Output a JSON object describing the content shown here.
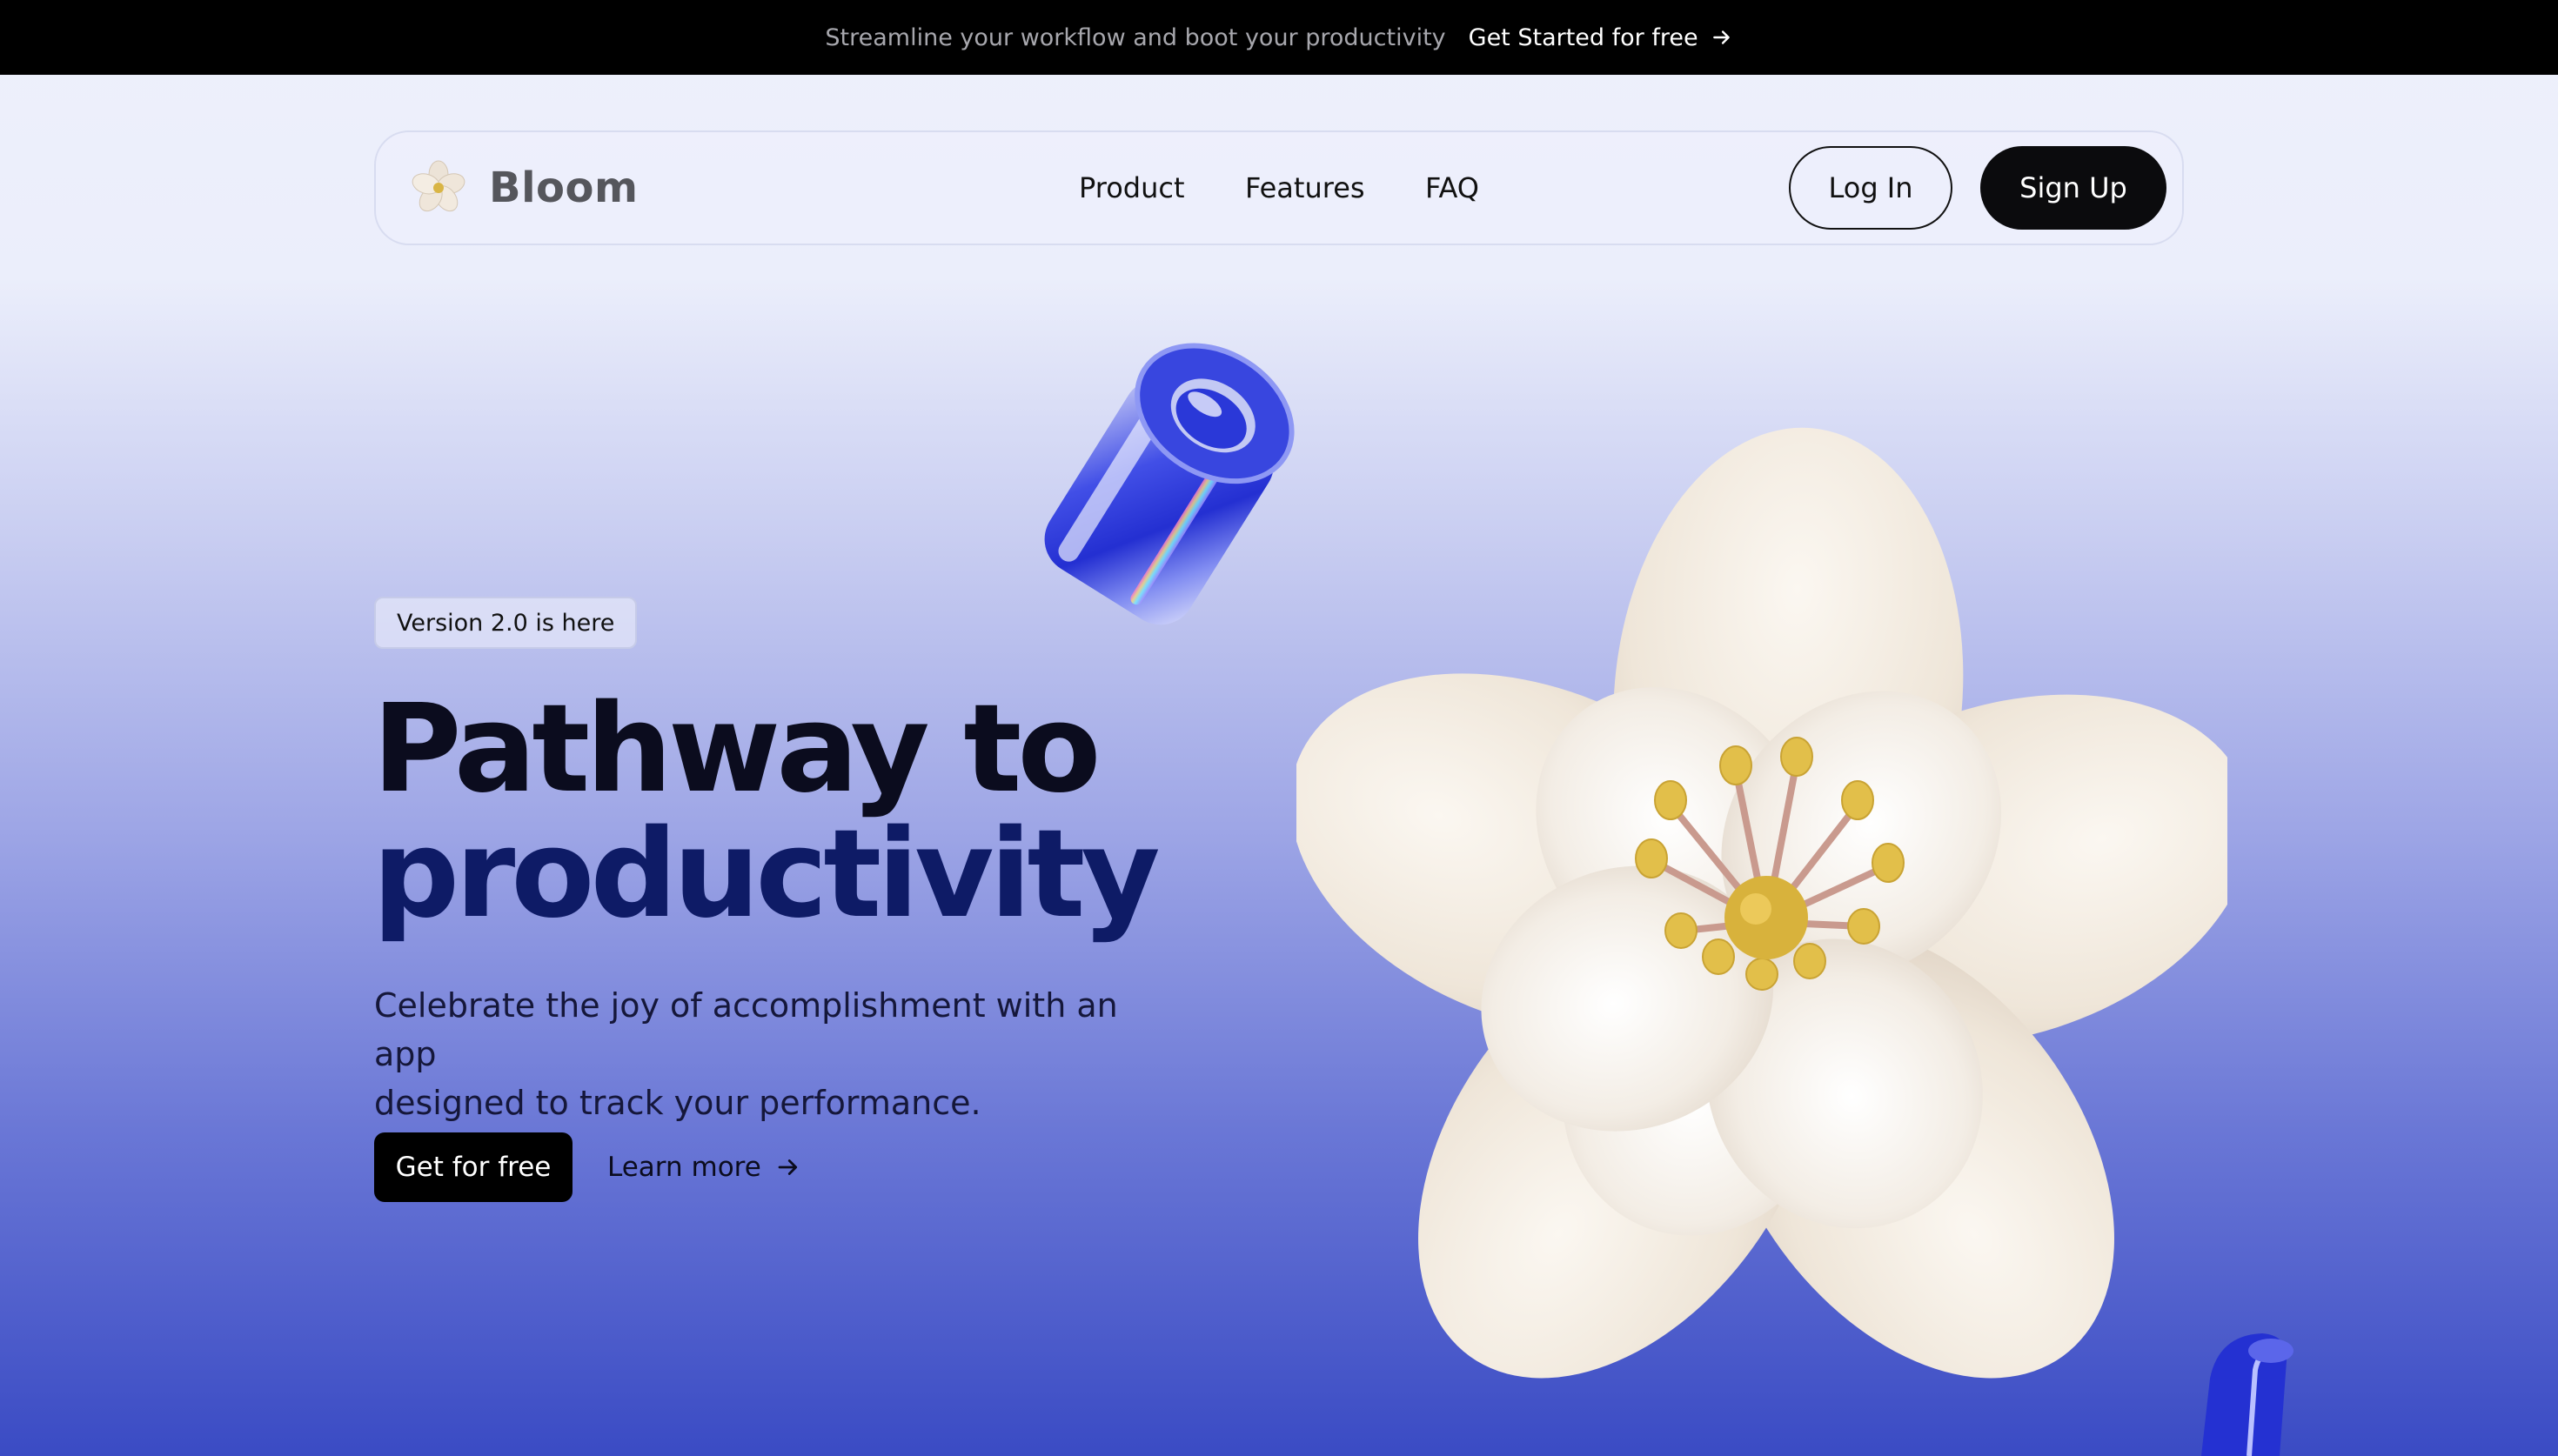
{
  "topbar": {
    "message": "Streamline your workflow and boot your productivity",
    "cta_label": "Get Started for free",
    "cta_icon": "arrow-right-icon"
  },
  "nav": {
    "brand": "Bloom",
    "brand_icon": "flower-logo-icon",
    "links": [
      "Product",
      "Features",
      "FAQ"
    ],
    "login_label": "Log In",
    "signup_label": "Sign Up"
  },
  "hero": {
    "badge": "Version 2.0 is here",
    "headline_line1": "Pathway to",
    "headline_line2": "productivity",
    "subtext_line1": "Celebrate the joy of accomplishment with an app",
    "subtext_line2": "designed to track your performance.",
    "primary_cta": "Get for free",
    "secondary_cta": "Learn more",
    "secondary_icon": "arrow-right-icon"
  },
  "colors": {
    "topbar_bg": "#000000",
    "headline_dark": "#0b0c1e",
    "headline_blue": "#0e1b66",
    "accent_blue": "#2233d6",
    "flower_petal": "#f3ece3",
    "stamen_yellow": "#e2bf4a"
  }
}
